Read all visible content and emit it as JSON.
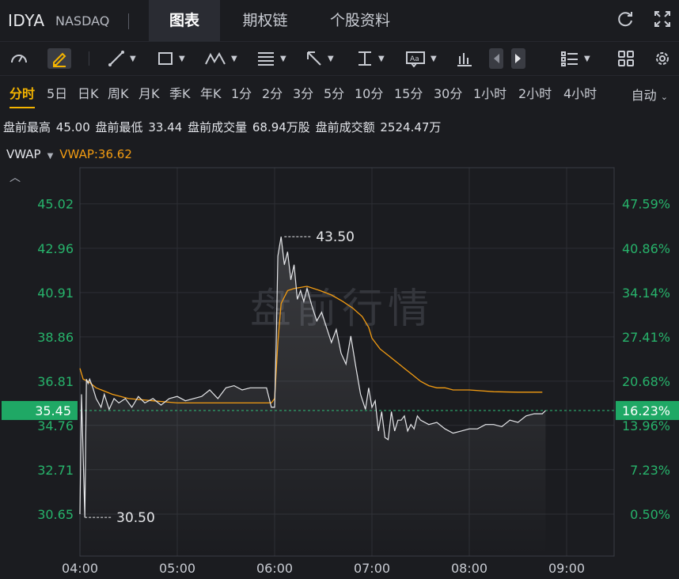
{
  "header": {
    "ticker": "IDYA",
    "exchange": "NASDAQ",
    "tabs": [
      {
        "label": "图表",
        "active": true
      },
      {
        "label": "期权链",
        "active": false
      },
      {
        "label": "个股资料",
        "active": false
      }
    ],
    "icons": [
      "refresh-icon",
      "fullscreen-icon"
    ]
  },
  "toolbar": {
    "icons": [
      "indicator-gauge-icon",
      "draw-pencil-icon",
      "trendline-icon",
      "rectangle-icon",
      "pattern-icon",
      "fib-icon",
      "arrow-icon",
      "price-range-icon",
      "text-note-icon",
      "volume-bars-icon",
      "prev-icon",
      "next-icon",
      "list-layout-icon",
      "grid-layout-icon",
      "settings-icon"
    ]
  },
  "periods": {
    "items": [
      "分时",
      "5日",
      "日K",
      "周K",
      "月K",
      "季K",
      "年K",
      "1分",
      "2分",
      "3分",
      "5分",
      "10分",
      "15分",
      "30分",
      "1小时",
      "2小时",
      "4小时"
    ],
    "active": "分时",
    "mode": "自动"
  },
  "stats": {
    "high_label": "盘前最高",
    "high": "45.00",
    "low_label": "盘前最低",
    "low": "33.44",
    "vol_label": "盘前成交量",
    "vol": "68.94万股",
    "amt_label": "盘前成交额",
    "amt": "2524.47万"
  },
  "indicator": {
    "name": "VWAP",
    "value_text": "VWAP:36.62"
  },
  "watermark": "盘前行情",
  "colors": {
    "price": "#e6e7ea",
    "vwap": "#f39c12",
    "axis_text": "#27b36b",
    "current_tag": "#1fa865",
    "background": "#1b1c20"
  },
  "chart_data": {
    "type": "line",
    "x_ticks": [
      "04:00",
      "05:00",
      "06:00",
      "07:00",
      "08:00",
      "09:00"
    ],
    "x_range": [
      "04:00",
      "09:00"
    ],
    "y_ticks": [
      "45.02",
      "42.96",
      "40.91",
      "38.86",
      "36.81",
      "34.76",
      "32.71",
      "30.65"
    ],
    "y_pct_ticks": [
      "47.59%",
      "40.86%",
      "34.14%",
      "27.41%",
      "20.68%",
      "13.96%",
      "7.23%",
      "0.50%"
    ],
    "ylim": [
      29.4,
      46.9
    ],
    "current_price": "35.45",
    "current_pct": "16.23%",
    "annotations": [
      {
        "text": "43.50",
        "x": "06:06",
        "y": 43.5
      },
      {
        "text": "30.50",
        "x": "04:03",
        "y": 30.5
      }
    ],
    "series": [
      {
        "name": "price",
        "x": [
          "04:00",
          "04:01",
          "04:03",
          "04:04",
          "04:05",
          "04:06",
          "04:08",
          "04:10",
          "04:13",
          "04:15",
          "04:18",
          "04:21",
          "04:24",
          "04:28",
          "04:32",
          "04:36",
          "04:40",
          "04:45",
          "04:50",
          "04:55",
          "05:00",
          "05:05",
          "05:10",
          "05:15",
          "05:20",
          "05:25",
          "05:30",
          "05:35",
          "05:40",
          "05:45",
          "05:50",
          "05:55",
          "05:58",
          "06:00",
          "06:01",
          "06:02",
          "06:04",
          "06:06",
          "06:08",
          "06:10",
          "06:12",
          "06:14",
          "06:16",
          "06:18",
          "06:20",
          "06:23",
          "06:26",
          "06:29",
          "06:32",
          "06:35",
          "06:38",
          "06:41",
          "06:44",
          "06:47",
          "06:50",
          "06:53",
          "06:56",
          "06:58",
          "07:00",
          "07:02",
          "07:04",
          "07:06",
          "07:08",
          "07:10",
          "07:12",
          "07:14",
          "07:16",
          "07:18",
          "07:20",
          "07:22",
          "07:24",
          "07:26",
          "07:28",
          "07:30",
          "07:35",
          "07:40",
          "07:45",
          "07:50",
          "07:55",
          "08:00",
          "08:05",
          "08:10",
          "08:15",
          "08:20",
          "08:25",
          "08:30",
          "08:35",
          "08:40",
          "08:45",
          "08:47"
        ],
        "values": [
          30.65,
          36.2,
          30.5,
          36.9,
          36.7,
          36.9,
          36.5,
          36.0,
          35.6,
          36.2,
          35.5,
          36.0,
          35.8,
          36.0,
          35.6,
          36.1,
          35.8,
          36.0,
          35.7,
          36.0,
          36.1,
          35.9,
          36.0,
          36.1,
          36.4,
          36.0,
          36.5,
          36.6,
          36.4,
          36.5,
          36.5,
          36.5,
          35.6,
          35.6,
          38.6,
          42.6,
          43.5,
          42.2,
          42.8,
          41.5,
          42.2,
          40.6,
          41.0,
          40.5,
          41.1,
          40.3,
          39.6,
          40.0,
          39.3,
          38.6,
          39.2,
          38.1,
          37.6,
          38.9,
          37.5,
          36.2,
          35.5,
          36.5,
          35.6,
          35.9,
          34.5,
          35.4,
          34.2,
          34.1,
          35.4,
          34.5,
          35.0,
          35.0,
          35.2,
          34.5,
          34.8,
          34.6,
          35.2,
          35.0,
          34.8,
          34.9,
          34.6,
          34.4,
          34.5,
          34.6,
          34.6,
          34.8,
          34.8,
          34.7,
          35.0,
          34.9,
          35.2,
          35.3,
          35.3,
          35.45
        ]
      },
      {
        "name": "VWAP",
        "x": [
          "04:00",
          "04:02",
          "04:05",
          "04:10",
          "04:20",
          "04:30",
          "04:45",
          "05:00",
          "05:20",
          "05:40",
          "05:58",
          "06:00",
          "06:02",
          "06:04",
          "06:08",
          "06:12",
          "06:20",
          "06:28",
          "06:35",
          "06:42",
          "06:48",
          "06:54",
          "06:58",
          "07:00",
          "07:05",
          "07:10",
          "07:15",
          "07:20",
          "07:25",
          "07:30",
          "07:35",
          "07:40",
          "07:45",
          "07:50",
          "08:00",
          "08:15",
          "08:30",
          "08:45"
        ],
        "values": [
          37.4,
          36.9,
          36.8,
          36.5,
          36.2,
          36.0,
          35.9,
          35.8,
          35.8,
          35.8,
          35.8,
          36.0,
          38.6,
          40.4,
          41.0,
          41.1,
          41.2,
          41.0,
          40.8,
          40.5,
          40.2,
          39.8,
          39.3,
          38.8,
          38.3,
          38.0,
          37.7,
          37.4,
          37.1,
          36.8,
          36.6,
          36.5,
          36.5,
          36.4,
          36.4,
          36.32,
          36.3,
          36.3
        ]
      }
    ]
  }
}
